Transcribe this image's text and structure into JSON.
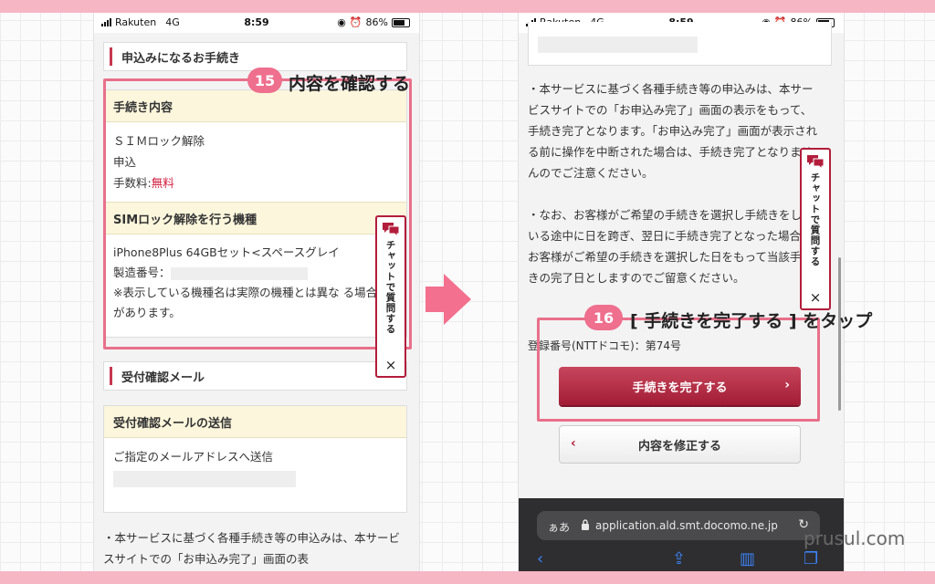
{
  "status_left": {
    "carrier": "Rakuten",
    "network": "4G",
    "time": "8:59",
    "battery": "86%"
  },
  "status_right": {
    "carrier": "Rakuten",
    "network": "4G",
    "time": "8:59",
    "battery": "86%"
  },
  "left": {
    "section1": "申込みになるお手続き",
    "procedure": {
      "header": "手続き内容",
      "line1": "ＳＩＭロック解除",
      "line2": "申込",
      "fee_label": "手数料:",
      "fee_value": "無料"
    },
    "device": {
      "header": "SIMロック解除を行う機種",
      "model": "iPhone8Plus 64GBセット<スペースグレイ",
      "serial_label": "製造番号：",
      "note": "※表示している機種名は実際の機種とは異な る場合があります。"
    },
    "section2": "受付確認メール",
    "mail": {
      "header": "受付確認メールの送信",
      "body": "ご指定のメールアドレスへ送信"
    },
    "notice": "・本サービスに基づく各種手続き等の申込みは、本サービスサイトでの「お申込み完了」画面の表"
  },
  "callout15": {
    "num": "15",
    "text": "内容を確認する"
  },
  "chat": {
    "label": "チャットで質問する",
    "close": "×"
  },
  "right": {
    "para1": "・本サービスに基づく各種手続き等の申込みは、本サービスサイトでの「お申込み完了」画面の表示をもって、手続き完了となります。「お申込み完了」画面が表示される前に操作を中断された場合は、手続き完了となりませんのでご注意ください。",
    "para2": "・なお、お客様がご希望の手続きを選択し手続きをしている途中に日を跨ぎ、翌日に手続き完了となった場合、お客様がご希望の手続きを選択した日をもって当該手続きの完了日としますのでご留意ください。",
    "reg_number": "登録番号(NTTドコモ)：第74号",
    "primary_button": "手続きを完了する",
    "secondary_button": "内容を修正する",
    "aa": "ぁあ",
    "url": "application.ald.smt.docomo.ne.jp"
  },
  "callout16": {
    "num": "16",
    "text": "[ 手続きを完了する ] をタップ"
  },
  "watermark": "prusul.com",
  "colors": {
    "accent": "#c7374f",
    "badge": "#ef6f8e",
    "highlight": "#e8708b",
    "band": "#f6b6c3"
  }
}
